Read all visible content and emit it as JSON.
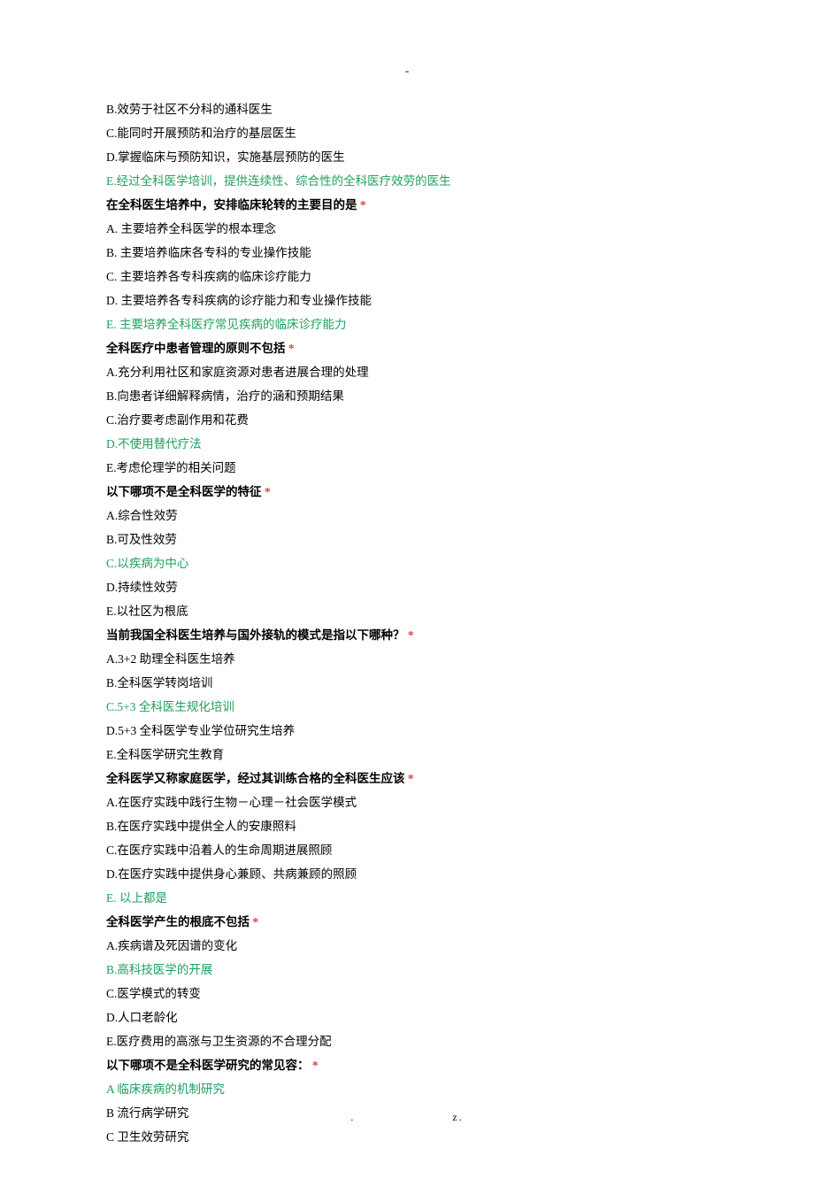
{
  "header_dash": "-",
  "prev_options": {
    "b": "B.效劳于社区不分科的通科医生",
    "c": "C.能同时开展预防和治疗的基层医生",
    "d": "D.掌握临床与预防知识，实施基层预防的医生",
    "e": "E.经过全科医学培训，提供连续性、综合性的全科医疗效劳的医生"
  },
  "questions": [
    {
      "q": "在全科医生培养中，安排临床轮转的主要目的是",
      "star": "*",
      "opts": [
        {
          "t": "A.  主要培养全科医学的根本理念",
          "a": false
        },
        {
          "t": "B.  主要培养临床各专科的专业操作技能",
          "a": false
        },
        {
          "t": "C.  主要培养各专科疾病的临床诊疗能力",
          "a": false
        },
        {
          "t": "D.  主要培养各专科疾病的诊疗能力和专业操作技能",
          "a": false
        },
        {
          "t": "E.  主要培养全科医疗常见疾病的临床诊疗能力",
          "a": true
        }
      ]
    },
    {
      "q": "全科医疗中患者管理的原则不包括",
      "star": "*",
      "opts": [
        {
          "t": "A.充分利用社区和家庭资源对患者进展合理的处理",
          "a": false
        },
        {
          "t": "B.向患者详细解释病情，治疗的涵和预期结果",
          "a": false
        },
        {
          "t": "C.治疗要考虑副作用和花费",
          "a": false
        },
        {
          "t": "D.不使用替代疗法",
          "a": true
        },
        {
          "t": "E.考虑伦理学的相关问题",
          "a": false
        }
      ]
    },
    {
      "q": "以下哪项不是全科医学的特征",
      "star": "*",
      "opts": [
        {
          "t": "A.综合性效劳",
          "a": false
        },
        {
          "t": "B.可及性效劳",
          "a": false
        },
        {
          "t": "C.以疾病为中心",
          "a": true
        },
        {
          "t": "D.持续性效劳",
          "a": false
        },
        {
          "t": "E.以社区为根底",
          "a": false
        }
      ]
    },
    {
      "q": "当前我国全科医生培养与国外接轨的模式是指以下哪种？",
      "star": "*",
      "opts": [
        {
          "t": "A.3+2 助理全科医生培养",
          "a": false
        },
        {
          "t": "B.全科医学转岗培训",
          "a": false
        },
        {
          "t": "C.5+3 全科医生规化培训",
          "a": true
        },
        {
          "t": "D.5+3 全科医学专业学位研究生培养",
          "a": false
        },
        {
          "t": "E.全科医学研究生教育",
          "a": false
        }
      ]
    },
    {
      "q": "全科医学又称家庭医学，经过其训练合格的全科医生应该",
      "star": "*",
      "opts": [
        {
          "t": "A.在医疗实践中践行生物－心理－社会医学模式",
          "a": false
        },
        {
          "t": "B.在医疗实践中提供全人的安康照料",
          "a": false
        },
        {
          "t": "C.在医疗实践中沿着人的生命周期进展照顾",
          "a": false
        },
        {
          "t": "D.在医疗实践中提供身心兼顾、共病兼顾的照顾",
          "a": false
        },
        {
          "t": "E. 以上都是",
          "a": true
        }
      ]
    },
    {
      "q": "全科医学产生的根底不包括",
      "star": "*",
      "opts": [
        {
          "t": "A.疾病谱及死因谱的变化",
          "a": false
        },
        {
          "t": "B.高科技医学的开展",
          "a": true
        },
        {
          "t": "C.医学模式的转变",
          "a": false
        },
        {
          "t": "D.人口老龄化",
          "a": false
        },
        {
          "t": "E.医疗费用的高涨与卫生资源的不合理分配",
          "a": false
        }
      ]
    },
    {
      "q": "以下哪项不是全科医学研究的常见容：",
      "star": "*",
      "opts": [
        {
          "t": "A  临床疾病的机制研究",
          "a": true
        },
        {
          "t": "B  流行病学研究",
          "a": false
        },
        {
          "t": "C  卫生效劳研究",
          "a": false
        }
      ]
    }
  ],
  "footer": {
    "dot": ".",
    "z": "z."
  }
}
